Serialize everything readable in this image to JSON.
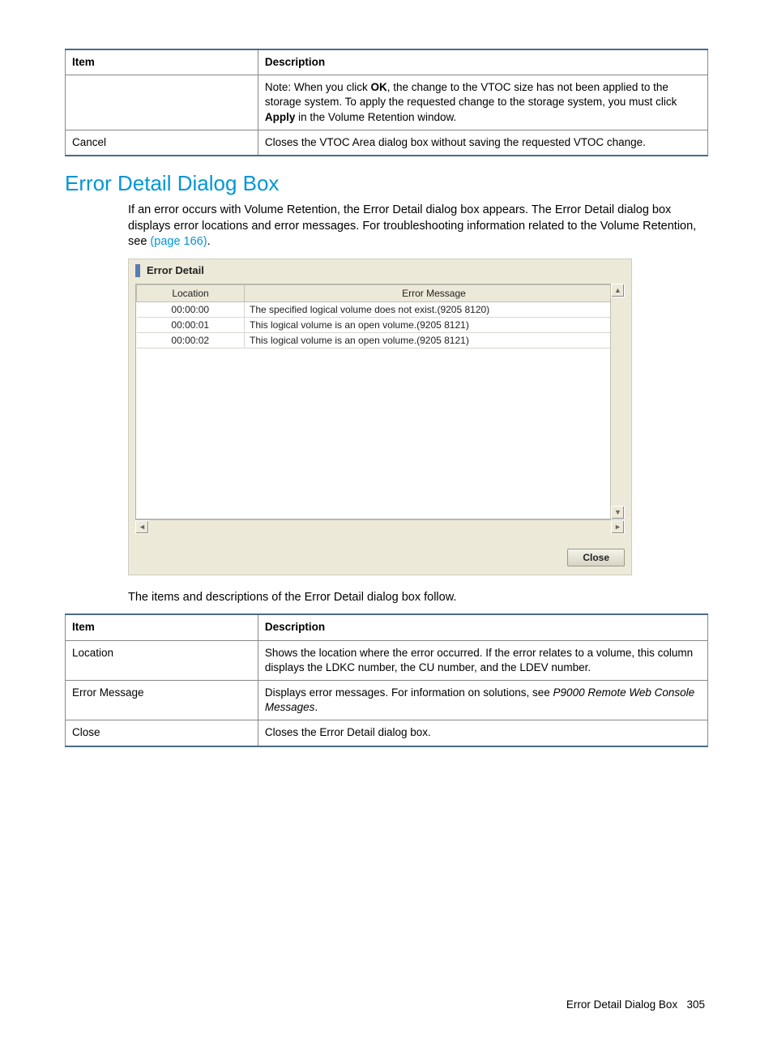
{
  "table1": {
    "headers": {
      "item": "Item",
      "desc": "Description"
    },
    "rows": [
      {
        "item": "",
        "desc_prefix": "Note: When you click ",
        "desc_bold1": "OK",
        "desc_mid": ", the change to the VTOC size has not been applied to the storage system. To apply the requested change to the storage system, you must click ",
        "desc_bold2": "Apply",
        "desc_suffix": " in the Volume Retention window."
      },
      {
        "item": "Cancel",
        "desc": "Closes the VTOC Area dialog box without saving the requested VTOC change."
      }
    ]
  },
  "heading": "Error Detail Dialog Box",
  "intro": {
    "t1": "If an error occurs with Volume Retention, the Error Detail dialog box appears. The Error Detail dialog box displays error locations and error messages. For troubleshooting information related to the Volume Retention, see ",
    "link": "(page 166)",
    "t2": "."
  },
  "dialog": {
    "title": "Error Detail",
    "headers": {
      "loc": "Location",
      "msg": "Error Message"
    },
    "rows": [
      {
        "loc": "00:00:00",
        "msg": "The specified logical volume does not exist.(9205 8120)"
      },
      {
        "loc": "00:00:01",
        "msg": "This logical volume is an open volume.(9205 8121)"
      },
      {
        "loc": "00:00:02",
        "msg": "This logical volume is an open volume.(9205 8121)"
      }
    ],
    "close": "Close",
    "arrows": {
      "up": "▲",
      "down": "▼",
      "left": "◄",
      "right": "►"
    }
  },
  "mid_text": "The items and descriptions of the Error Detail dialog box follow.",
  "table2": {
    "headers": {
      "item": "Item",
      "desc": "Description"
    },
    "rows": [
      {
        "item": "Location",
        "desc": "Shows the location where the error occurred. If the error relates to a volume, this column displays the LDKC number, the CU number, and the LDEV number."
      },
      {
        "item": "Error Message",
        "desc_prefix": "Displays error messages. For information on solutions, see ",
        "desc_italic": "P9000 Remote Web Console Messages",
        "desc_suffix": "."
      },
      {
        "item": "Close",
        "desc": "Closes the Error Detail dialog box."
      }
    ]
  },
  "footer": {
    "title": "Error Detail Dialog Box",
    "page": "305"
  }
}
